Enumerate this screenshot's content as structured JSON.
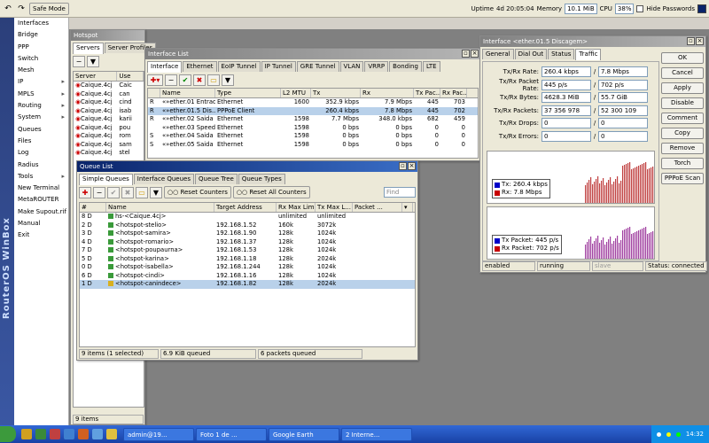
{
  "toolbar": {
    "undo": "↶",
    "redo": "↷",
    "safe_mode": "Safe Mode",
    "uptime_label": "Uptime",
    "uptime": "4d 20:05:04",
    "memory_label": "Memory",
    "memory": "10.1 MiB",
    "cpu_label": "CPU",
    "cpu": "38%",
    "hide_passwords": "Hide Passwords"
  },
  "sidebar": {
    "brand": "RouterOS WinBox",
    "items": [
      {
        "label": "Interfaces",
        "arrow": ""
      },
      {
        "label": "Bridge",
        "arrow": ""
      },
      {
        "label": "PPP",
        "arrow": ""
      },
      {
        "label": "Switch",
        "arrow": ""
      },
      {
        "label": "Mesh",
        "arrow": ""
      },
      {
        "label": "IP",
        "arrow": "▸"
      },
      {
        "label": "MPLS",
        "arrow": "▸"
      },
      {
        "label": "Routing",
        "arrow": "▸"
      },
      {
        "label": "System",
        "arrow": "▸"
      },
      {
        "label": "Queues",
        "arrow": ""
      },
      {
        "label": "Files",
        "arrow": ""
      },
      {
        "label": "Log",
        "arrow": ""
      },
      {
        "label": "Radius",
        "arrow": ""
      },
      {
        "label": "Tools",
        "arrow": "▸"
      },
      {
        "label": "New Terminal",
        "arrow": ""
      },
      {
        "label": "MetaROUTER",
        "arrow": ""
      },
      {
        "label": "Make Supout.rif",
        "arrow": ""
      },
      {
        "label": "Manual",
        "arrow": ""
      },
      {
        "label": "Exit",
        "arrow": ""
      }
    ]
  },
  "hotspot": {
    "title": "Hotspot",
    "tabs": [
      "Servers",
      "Server Profiles"
    ],
    "col_server": "Server",
    "col_user": "Use",
    "rows": [
      {
        "server": "Caique.4cj",
        "user": "Caic"
      },
      {
        "server": "Caique.4cj",
        "user": "can"
      },
      {
        "server": "Caique.4cj",
        "user": "cind"
      },
      {
        "server": "Caique.4cj",
        "user": "isab"
      },
      {
        "server": "Caique.4cj",
        "user": "karii"
      },
      {
        "server": "Caique.4cj",
        "user": "pou"
      },
      {
        "server": "Caique.4cj",
        "user": "rom"
      },
      {
        "server": "Caique.4cj",
        "user": "sam"
      },
      {
        "server": "Caique.4cj",
        "user": "stel"
      }
    ],
    "status": "9 items"
  },
  "iface": {
    "title": "Interface List",
    "tabs": [
      "Interface",
      "Ethernet",
      "EoIP Tunnel",
      "IP Tunnel",
      "GRE Tunnel",
      "VLAN",
      "VRRP",
      "Bonding",
      "LTE"
    ],
    "headers": [
      "",
      "Name",
      "Type",
      "L2 MTU",
      "Tx",
      "Rx",
      "Tx Pac...",
      "Rx Pac..."
    ],
    "rows": [
      [
        "R",
        "«»ether.01 Entrada",
        "Ethernet",
        "1600",
        "352.9 kbps",
        "7.9 Mbps",
        "445",
        "703"
      ],
      [
        "R",
        "«»ether.01.5 Dis...",
        "PPPoE Client",
        "",
        "260.4 kbps",
        "7.8 Mbps",
        "445",
        "702"
      ],
      [
        "R",
        "«»ether.02 Saida",
        "Ethernet",
        "1598",
        "7.7 Mbps",
        "348.0 kbps",
        "682",
        "459"
      ],
      [
        "",
        "«»ether.03 Speedr",
        "Ethernet",
        "1598",
        "0 bps",
        "0 bps",
        "0",
        "0"
      ],
      [
        "S",
        "«»ether.04 Saida",
        "Ethernet",
        "1598",
        "0 bps",
        "0 bps",
        "0",
        "0"
      ],
      [
        "S",
        "«»ether.05 Saida",
        "Ethernet",
        "1598",
        "0 bps",
        "0 bps",
        "0",
        "0"
      ]
    ]
  },
  "queue": {
    "title": "Queue List",
    "tabs": [
      "Simple Queues",
      "Interface Queues",
      "Queue Tree",
      "Queue Types"
    ],
    "reset": "Reset Counters",
    "reset_all": "Reset All Counters",
    "find": "Find",
    "headers": [
      "#",
      "Name",
      "Target Address",
      "Rx Max Limit",
      "Tx Max L...",
      "Packet ..."
    ],
    "rows": [
      [
        "8 D",
        "hs-<Caique.4cj>",
        "",
        "unlimited",
        "unlimited",
        ""
      ],
      [
        "2 D",
        "<hotspot-stelio>",
        "192.168.1.52",
        "160k",
        "3072k",
        ""
      ],
      [
        "3 D",
        "<hotspot-samira>",
        "192.168.1.90",
        "128k",
        "1024k",
        ""
      ],
      [
        "4 D",
        "<hotspot-romario>",
        "192.168.1.37",
        "128k",
        "1024k",
        ""
      ],
      [
        "7 D",
        "<hotspot-poupaurna>",
        "192.168.1.53",
        "128k",
        "1024k",
        ""
      ],
      [
        "5 D",
        "<hotspot-karina>",
        "192.168.1.18",
        "128k",
        "2024k",
        ""
      ],
      [
        "0 D",
        "<hotspot-isabella>",
        "192.168.1.244",
        "128k",
        "1024k",
        ""
      ],
      [
        "6 D",
        "<hotspot-cindi>",
        "192.168.1.16",
        "128k",
        "1024k",
        ""
      ],
      [
        "1 D",
        "<hotspot-canindece>",
        "192.168.1.82",
        "128k",
        "2024k",
        ""
      ]
    ],
    "status": [
      "9 items (1 selected)",
      "6.9 KiB queued",
      "6 packets queued"
    ]
  },
  "detail": {
    "title": "Interface <ether.01.5 Discagem>",
    "tabs": [
      "General",
      "Dial Out",
      "Status",
      "Traffic"
    ],
    "fields": [
      {
        "label": "Tx/Rx Rate:",
        "tx": "260.4 kbps",
        "rx": "7.8 Mbps"
      },
      {
        "label": "Tx/Rx Packet Rate:",
        "tx": "445 p/s",
        "rx": "702 p/s"
      },
      {
        "label": "Tx/Rx Bytes:",
        "tx": "4628.3 MiB",
        "rx": "55.7 GiB"
      },
      {
        "label": "Tx/Rx Packets:",
        "tx": "37 356 978",
        "rx": "52 300 109"
      },
      {
        "label": "Tx/Rx Drops:",
        "tx": "0",
        "rx": "0"
      },
      {
        "label": "Tx/Rx Errors:",
        "tx": "0",
        "rx": "0"
      }
    ],
    "legend1": [
      {
        "label": "Tx:  260.4 kbps",
        "color": "#0000c8"
      },
      {
        "label": "Rx:  7.8 Mbps",
        "color": "#c80000"
      }
    ],
    "legend2": [
      {
        "label": "Tx Packet:  445 p/s",
        "color": "#0000c8"
      },
      {
        "label": "Rx Packet:  702 p/s",
        "color": "#c80000"
      }
    ],
    "buttons": [
      "OK",
      "Cancel",
      "Apply",
      "Disable",
      "Comment",
      "Copy",
      "Remove",
      "Torch",
      "PPPoE Scan"
    ],
    "status": [
      "enabled",
      "running",
      "slave",
      "Status: connected"
    ]
  },
  "taskbar": {
    "tasks": [
      "admin@19...",
      "Foto 1 de ...",
      "Google Earth",
      "2 Interne..."
    ],
    "clock": "14:32"
  }
}
